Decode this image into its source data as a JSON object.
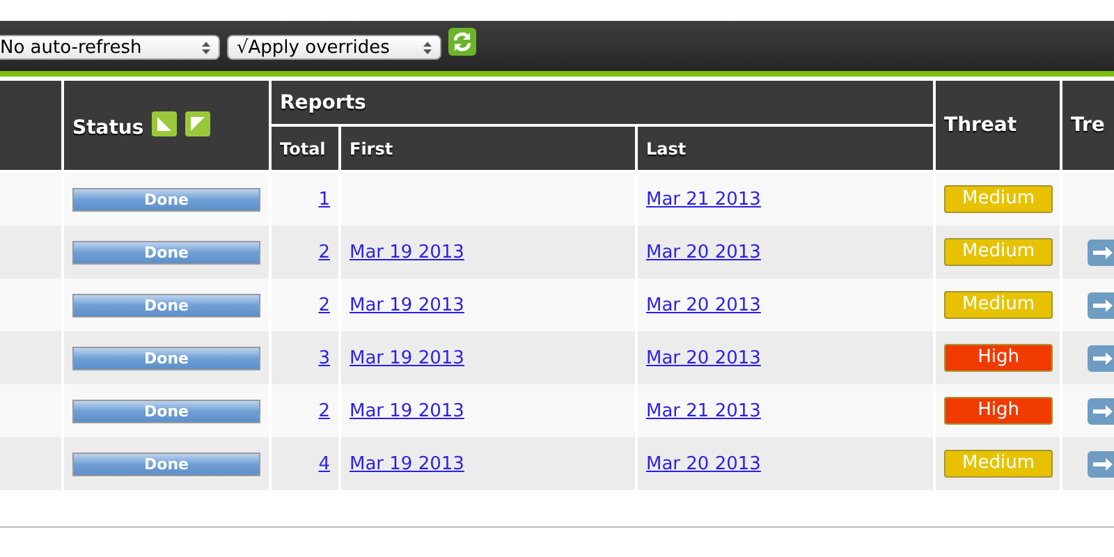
{
  "toolbar": {
    "refresh_select": "No auto-refresh",
    "overrides_select": "√Apply overrides"
  },
  "table": {
    "columns": {
      "status": "Status",
      "reports": "Reports",
      "total": "Total",
      "first": "First",
      "last": "Last",
      "threat": "Threat",
      "column_7": "Tre"
    },
    "rows": [
      {
        "status": "Done",
        "total": "1",
        "first": "",
        "last": "Mar 21 2013",
        "threat": "Medium",
        "color": "#e6c200",
        "trend": false
      },
      {
        "status": "Done",
        "total": "2",
        "first": "Mar 19 2013",
        "last": "Mar 20 2013",
        "threat": "Medium",
        "color": "#e6c200",
        "trend": true
      },
      {
        "status": "Done",
        "total": "2",
        "first": "Mar 19 2013",
        "last": "Mar 20 2013",
        "threat": "Medium",
        "color": "#e6c200",
        "trend": true
      },
      {
        "status": "Done",
        "total": "3",
        "first": "Mar 19 2013",
        "last": "Mar 20 2013",
        "threat": "High",
        "color": "#f03a00",
        "trend": true
      },
      {
        "status": "Done",
        "total": "2",
        "first": "Mar 19 2013",
        "last": "Mar 21 2013",
        "threat": "High",
        "color": "#f03a00",
        "trend": true
      },
      {
        "status": "Done",
        "total": "4",
        "first": "Mar 19 2013",
        "last": "Mar 20 2013",
        "threat": "Medium",
        "color": "#e6c200",
        "trend": true
      }
    ]
  }
}
